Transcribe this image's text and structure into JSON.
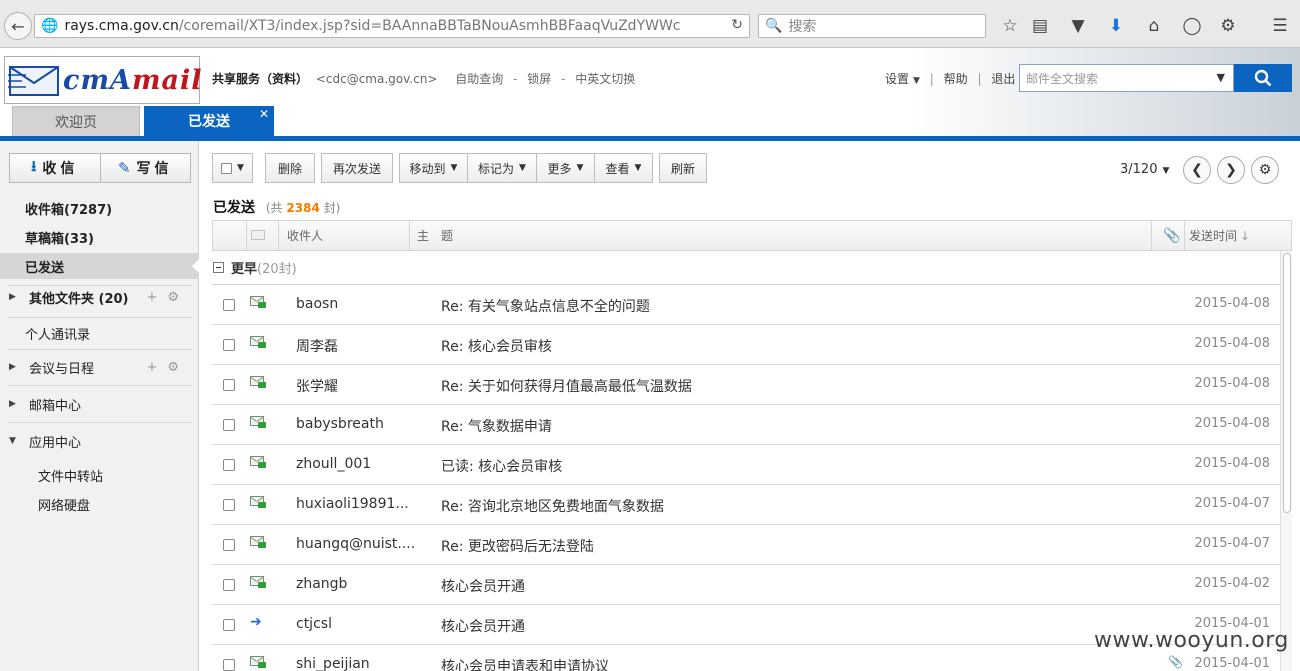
{
  "browser": {
    "url_host": "rays.cma.gov.cn",
    "url_path": "/coremail/XT3/index.jsp?sid=BAAnnaBBTaBNouAsmhBBFaaqVuZdYWWc",
    "search_placeholder": "搜索"
  },
  "header": {
    "logo_text_1": "cmA",
    "logo_text_2": "mail",
    "account_name": "共享服务（资料）",
    "account_email": "<cdc@cma.gov.cn>",
    "links": [
      "自助查询",
      "锁屏",
      "中英文切换"
    ],
    "right_links": [
      "设置",
      "帮助",
      "退出"
    ],
    "fulltext_placeholder": "邮件全文搜索",
    "tabs": [
      {
        "label": "欢迎页"
      },
      {
        "label": "已发送"
      }
    ]
  },
  "sidebar": {
    "receive_label": "收信",
    "compose_label": "写信",
    "folders": [
      {
        "label": "收件箱(7287)"
      },
      {
        "label": "草稿箱(33)"
      },
      {
        "label": "已发送"
      }
    ],
    "other_folders": "其他文件夹 (20)",
    "contacts": "个人通讯录",
    "calendar": "会议与日程",
    "mailbox_center": "邮箱中心",
    "app_center": "应用中心",
    "apps": [
      "文件中转站",
      "网络硬盘"
    ]
  },
  "toolbar": {
    "delete": "删除",
    "resend": "再次发送",
    "move_to": "移动到",
    "mark_as": "标记为",
    "more": "更多",
    "view": "查看",
    "refresh": "刷新",
    "pager": "3/120"
  },
  "folder": {
    "title": "已发送",
    "count_prefix": "(共",
    "count": "2384",
    "count_suffix": "封)"
  },
  "columns": {
    "recipient": "收件人",
    "subject": "主　题",
    "sent_time": "发送时间"
  },
  "group": {
    "name": "更早",
    "count": "(20封)"
  },
  "mails": [
    {
      "recipient": "baosn",
      "subject": "Re: 有关气象站点信息不全的问题",
      "date": "2015-04-08",
      "icon": "envelope-icon"
    },
    {
      "recipient": "周李磊",
      "subject": "Re: 核心会员审核",
      "date": "2015-04-08",
      "icon": "envelope-icon"
    },
    {
      "recipient": "张学耀",
      "subject": "Re: 关于如何获得月值最高最低气温数据",
      "date": "2015-04-08",
      "icon": "envelope-icon"
    },
    {
      "recipient": "babysbreath",
      "subject": "Re: 气象数据申请",
      "date": "2015-04-08",
      "icon": "envelope-icon"
    },
    {
      "recipient": "zhoull_001",
      "subject": "已读: 核心会员审核",
      "date": "2015-04-08",
      "icon": "envelope-icon"
    },
    {
      "recipient": "huxiaoli19891...",
      "subject": "Re: 咨询北京地区免费地面气象数据",
      "date": "2015-04-07",
      "icon": "envelope-icon"
    },
    {
      "recipient": "huangq@nuist....",
      "subject": "Re: 更改密码后无法登陆",
      "date": "2015-04-07",
      "icon": "envelope-icon"
    },
    {
      "recipient": "zhangb",
      "subject": "核心会员开通",
      "date": "2015-04-02",
      "icon": "envelope-icon"
    },
    {
      "recipient": "ctjcsl",
      "subject": "核心会员开通",
      "date": "2015-04-01",
      "icon": "forward-icon"
    },
    {
      "recipient": "shi_peijian",
      "subject": "核心会员申请表和申请协议",
      "date": "2015-04-01",
      "icon": "envelope-icon"
    }
  ],
  "watermark": "www.wooyun.org",
  "colors": {
    "brand_blue": "#0b64c0",
    "count_orange": "#f57c00"
  }
}
